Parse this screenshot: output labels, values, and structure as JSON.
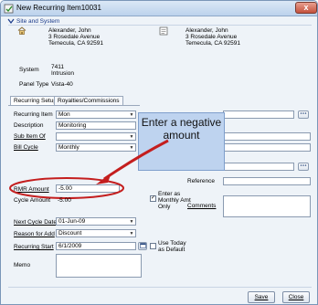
{
  "window": {
    "title": "New Recurring Item10031",
    "close_glyph": "x"
  },
  "site_section": {
    "title": "Site and System"
  },
  "site": {
    "name": "Alexander, John",
    "street": "3 Rosedale Avenue",
    "city": "Temecula, CA  92591"
  },
  "billing": {
    "name": "Alexander, John",
    "street": "3 Rosedale Avenue",
    "city": "Temecula, CA  92591"
  },
  "system": {
    "label": "System",
    "number": "7411",
    "type": "Intrusion"
  },
  "panel_type": {
    "label": "Panel Type",
    "value": "Vista-40"
  },
  "tabs": [
    {
      "label": "Recurring Setup"
    },
    {
      "label": "Royalties/Commissions"
    }
  ],
  "form": {
    "recurring_item": {
      "label": "Recurring Item",
      "value": "Mon"
    },
    "description": {
      "label": "Description",
      "value": "Monitoring"
    },
    "sub_item_of": {
      "label": "Sub Item Of",
      "value": ""
    },
    "bill_cycle": {
      "label": "Bill Cycle",
      "value": "Monthly"
    },
    "rmr_amount": {
      "label": "RMR Amount",
      "value": "-5.00"
    },
    "cycle_amount": {
      "label": "Cycle Amount",
      "value": "-5.00"
    },
    "enter_as_monthly": {
      "label": "Enter as Monthly Amt Only",
      "checked": true
    },
    "reference": {
      "label": "Reference",
      "value": ""
    },
    "comments": {
      "label": "Comments",
      "value": ""
    },
    "next_cycle_date": {
      "label": "Next Cycle Date",
      "value": "01-Jun-09"
    },
    "reason_for_add": {
      "label": "Reason for Add",
      "value": "Discount"
    },
    "recurring_start": {
      "label": "Recurring Start",
      "value": "6/1/2009"
    },
    "use_today": {
      "label": "Use Today as Default",
      "checked": false
    },
    "memo": {
      "label": "Memo",
      "value": ""
    }
  },
  "callout": {
    "text": "Enter a negative amount"
  },
  "buttons": {
    "save": "Save",
    "close": "Close"
  },
  "icons": {
    "home": "home-icon",
    "lookup": "ellipsis-icon",
    "dropdown": "chevron-down-icon"
  },
  "colors": {
    "callout_bg": "#bed3ef",
    "arrow": "#c41e1e",
    "section_title": "#1a3a8a"
  }
}
